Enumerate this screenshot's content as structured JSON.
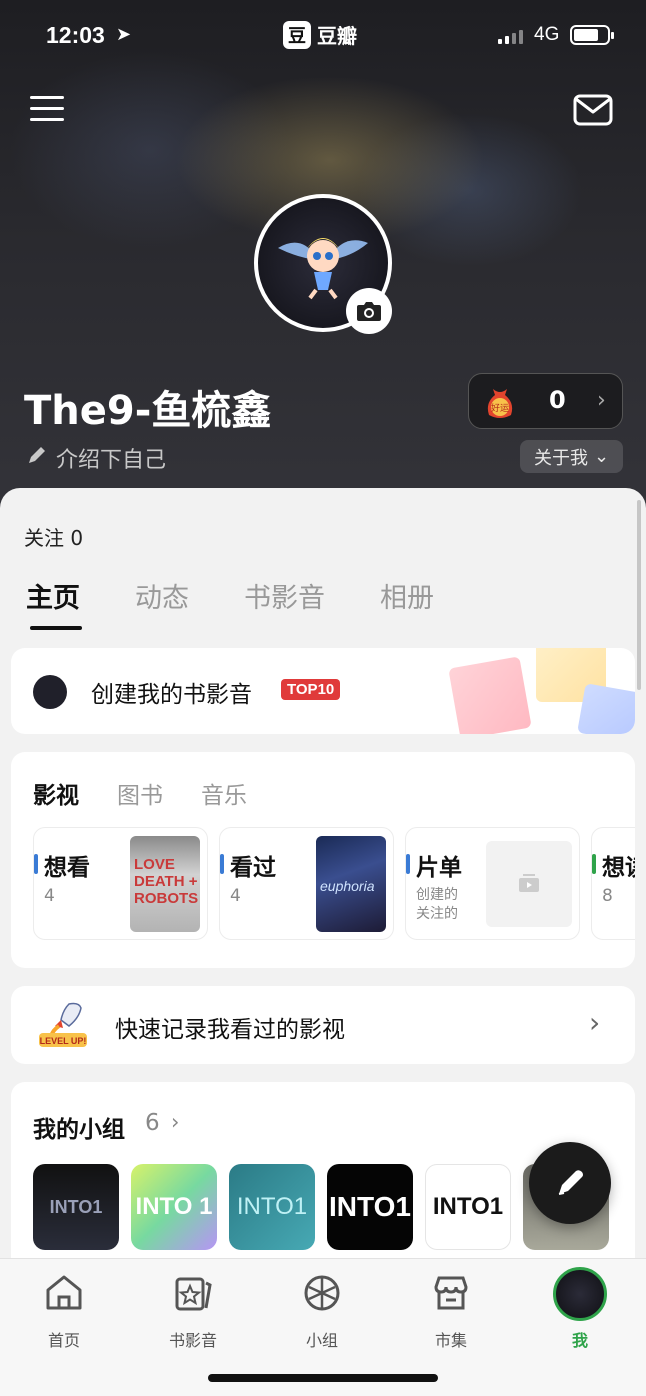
{
  "status_bar": {
    "time": "12:03",
    "app_name": "豆瓣",
    "app_logo": "豆",
    "network": "4G"
  },
  "profile": {
    "username": "The9-鱼梳鑫",
    "intro": "介绍下自己",
    "about_label": "关于我",
    "lucky_badge": "好运",
    "lucky_count": "0",
    "following": "关注 0"
  },
  "tabs": [
    {
      "label": "主页",
      "active": true
    },
    {
      "label": "动态",
      "active": false
    },
    {
      "label": "书影音",
      "active": false
    },
    {
      "label": "相册",
      "active": false
    }
  ],
  "create_card": {
    "label": "创建我的书影音",
    "badge": "TOP10"
  },
  "media": {
    "subtabs": [
      "影视",
      "图书",
      "音乐"
    ],
    "tiles": [
      {
        "label": "想看",
        "count": "4",
        "poster_text": "LOVE DEATH + ROBOTS"
      },
      {
        "label": "看过",
        "count": "4",
        "poster_text": "euphoria"
      },
      {
        "label": "片单",
        "line1": "创建的",
        "line2": "关注的"
      },
      {
        "label": "想读",
        "count": "8"
      }
    ]
  },
  "quick_record": {
    "label": "快速记录我看过的影视",
    "badge": "LEVEL UP!"
  },
  "groups": {
    "title": "我的小组",
    "count": "6",
    "items": [
      "INTO1",
      "INTO 1",
      "INTO1",
      "INTO1",
      "INTO1",
      ""
    ]
  },
  "bottom_nav": [
    {
      "label": "首页",
      "icon": "home-icon"
    },
    {
      "label": "书影音",
      "icon": "book-movie-icon"
    },
    {
      "label": "小组",
      "icon": "group-icon"
    },
    {
      "label": "市集",
      "icon": "market-icon"
    },
    {
      "label": "我",
      "icon": "avatar"
    }
  ],
  "colors": {
    "accent": "#2fa34a",
    "top10": "#e03a3a",
    "dark": "#1b1b1b"
  }
}
